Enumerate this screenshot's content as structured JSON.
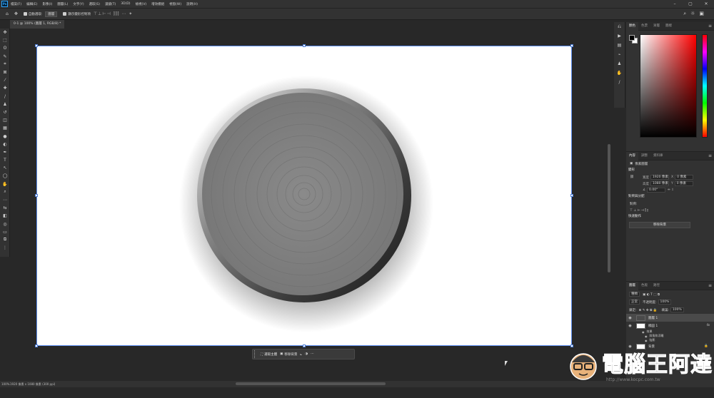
{
  "menubar": {
    "items": [
      "檔案(F)",
      "編輯(E)",
      "影像(I)",
      "圖層(L)",
      "文字(Y)",
      "選取(S)",
      "濾鏡(T)",
      "3D(D)",
      "檢視(V)",
      "增效模組",
      "視窗(W)",
      "說明(H)"
    ]
  },
  "window_controls": {
    "minimize": "–",
    "maximize": "▢",
    "close": "✕"
  },
  "optionsbar": {
    "auto_select_label": "自動選取:",
    "auto_select_value": "圖層",
    "show_transform_label": "顯示變形控制項"
  },
  "document_tab": {
    "title": "0-1 @ 100% (圖層 1, RGB/8) *"
  },
  "contextual_bar": {
    "select_subject": "選取主體",
    "remove_background": "移除背景"
  },
  "statusbar": {
    "zoom": "100%",
    "doc_info": "1920 像素 x 1080 像素 (300 ppi)"
  },
  "panels": {
    "color_tabs": [
      "顏色",
      "色票",
      "漸層",
      "圖樣"
    ],
    "props_tabs": [
      "內容",
      "調整",
      "資料庫"
    ],
    "props_type": "像素圖層",
    "transform": {
      "header": "變形",
      "width_label": "寬度",
      "width_value": "1920 像素",
      "height_label": "高度",
      "height_value": "1080 像素",
      "x_label": "X",
      "x_value": "0 像素",
      "y_label": "Y",
      "y_value": "0 像素",
      "angle_value": "0.00°"
    },
    "align": {
      "header": "對齊與分配",
      "sub": "對齊:"
    },
    "quick": {
      "header": "快速動作",
      "button": "移除背景"
    },
    "layers_tabs": [
      "圖層",
      "色版",
      "路徑"
    ],
    "layers": {
      "kind": "種類",
      "blend": "正常",
      "opacity_label": "不透明度:",
      "opacity_value": "100%",
      "lock_label": "鎖定:",
      "fill_label": "填滿:",
      "fill_value": "100%",
      "rows": [
        {
          "name": "圖層 1",
          "selected": true
        },
        {
          "name": "橢圓 1",
          "selected": false,
          "fx": true
        },
        {
          "name": "背景",
          "selected": false,
          "locked": true
        }
      ],
      "effects_label": "效果",
      "effect_items": [
        "斜角和浮雕",
        "陰影"
      ]
    }
  },
  "watermark": {
    "title": "電腦王阿達",
    "url": "http://www.kocpc.com.tw"
  }
}
